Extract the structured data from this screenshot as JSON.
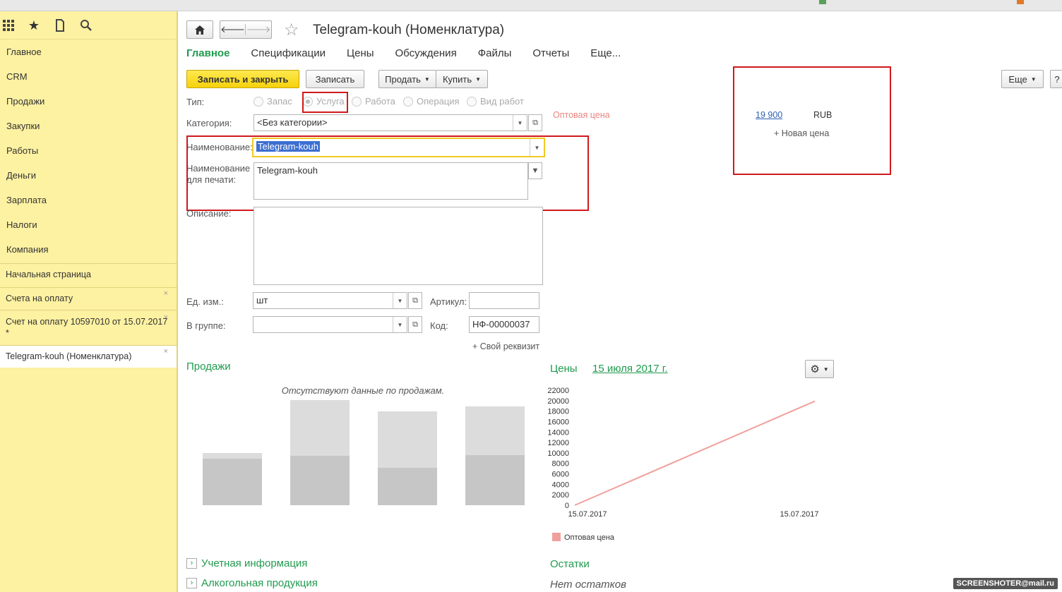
{
  "sidebar": {
    "nav": [
      "Главное",
      "CRM",
      "Продажи",
      "Закупки",
      "Работы",
      "Деньги",
      "Зарплата",
      "Налоги",
      "Компания"
    ],
    "open": [
      {
        "label": "Начальная страница"
      },
      {
        "label": "Счета на оплату",
        "close": "×"
      },
      {
        "label": "Счет на оплату 10597010 от 15.07.2017 *",
        "close": "×"
      },
      {
        "label": "Telegram-kouh (Номенклатура)",
        "close": "×"
      }
    ]
  },
  "header": {
    "title": "Telegram-kouh (Номенклатура)",
    "tabs": [
      "Главное",
      "Спецификации",
      "Цены",
      "Обсуждения",
      "Файлы",
      "Отчеты",
      "Еще..."
    ]
  },
  "toolbar": {
    "save_close": "Записать и закрыть",
    "save": "Записать",
    "sell": "Продать",
    "buy": "Купить",
    "more": "Еще",
    "help": "?"
  },
  "form": {
    "type_label": "Тип:",
    "types": [
      "Запас",
      "Услуга",
      "Работа",
      "Операция",
      "Вид работ"
    ],
    "category_label": "Категория:",
    "category_value": "<Без категории>",
    "name_label": "Наименование:",
    "name_value": "Telegram-kouh",
    "print_name_label_1": "Наименование",
    "print_name_label_2": "для печати:",
    "print_name_value": "Telegram-kouh",
    "description_label": "Описание:",
    "unit_label": "Ед. изм.:",
    "unit_value": "шт",
    "article_label": "Артикул:",
    "group_label": "В группе:",
    "code_label": "Код:",
    "code_value": "НФ-00000037",
    "custom_attr": "+ Свой реквизит"
  },
  "prices_panel": {
    "wholesale_label": "Оптовая цена",
    "value": "19 900",
    "currency": "RUB",
    "new_price": "+ Новая цена"
  },
  "sales": {
    "title": "Продажи",
    "empty": "Отсутствуют данные по продажам."
  },
  "prices_chart_header": {
    "title": "Цены",
    "date": "15 июля 2017 г."
  },
  "chart_data": {
    "type": "line",
    "x": [
      "15.07.2017",
      "15.07.2017"
    ],
    "series": [
      {
        "name": "Оптовая цена",
        "values": [
          0,
          19900
        ],
        "color": "#f0a09c"
      }
    ],
    "yticks": [
      "22000",
      "20000",
      "18000",
      "16000",
      "14000",
      "12000",
      "10000",
      "8000",
      "6000",
      "4000",
      "2000",
      "0"
    ],
    "ylim": [
      0,
      22000
    ],
    "legend": "bottom-left"
  },
  "bottom": {
    "accounting": "Учетная информация",
    "alcohol": "Алкогольная продукция",
    "stock_title": "Остатки",
    "stock_empty": "Нет остатков",
    "expand_icon": "›"
  },
  "watermark": "SCREENSHOTER@mail.ru"
}
